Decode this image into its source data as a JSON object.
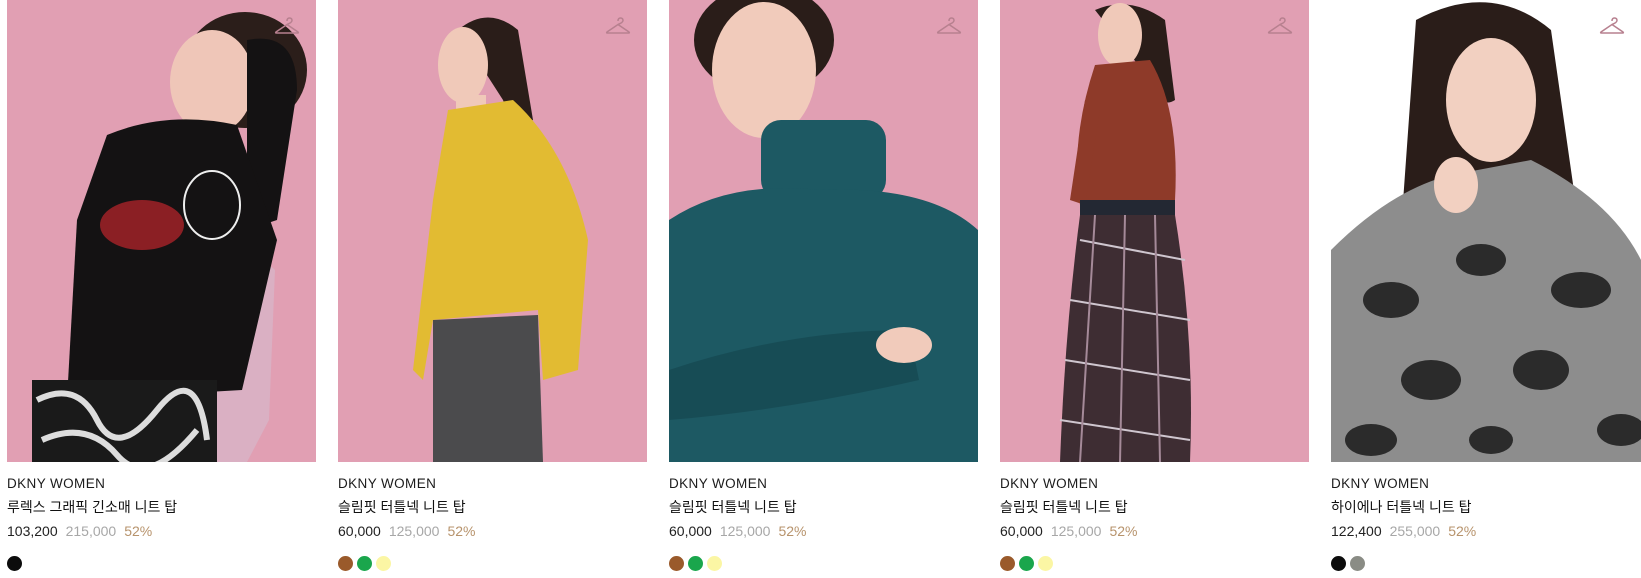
{
  "products": [
    {
      "brand": "DKNY WOMEN",
      "name": "루렉스 그래픽 긴소매 니트 탑",
      "sale_price": "103,200",
      "original_price": "215,000",
      "discount": "52%",
      "image": {
        "background": "#e19fb3",
        "garment": "#141213",
        "pose": "seated-on-chair"
      },
      "swatches": [
        "#0c0c0c"
      ],
      "icon": "hanger-icon"
    },
    {
      "brand": "DKNY WOMEN",
      "name": "슬림핏 터틀넥 니트 탑",
      "sale_price": "60,000",
      "original_price": "125,000",
      "discount": "52%",
      "image": {
        "background": "#e19fb3",
        "garment": "#e2bb32",
        "pose": "side-profile"
      },
      "swatches": [
        "#9a5a2b",
        "#1aa64c",
        "#fbf6a4"
      ],
      "icon": "hanger-icon"
    },
    {
      "brand": "DKNY WOMEN",
      "name": "슬림핏 터틀넥 니트 탑",
      "sale_price": "60,000",
      "original_price": "125,000",
      "discount": "52%",
      "image": {
        "background": "#e19fb3",
        "garment": "#1d5963",
        "pose": "arms-crossed"
      },
      "swatches": [
        "#9a5a2b",
        "#1aa64c",
        "#fbf6a4"
      ],
      "icon": "hanger-icon"
    },
    {
      "brand": "DKNY WOMEN",
      "name": "슬림핏 터틀넥 니트 탑",
      "sale_price": "60,000",
      "original_price": "125,000",
      "discount": "52%",
      "image": {
        "background": "#e19fb3",
        "garment": "#8e3a29",
        "pose": "standing-with-skirt"
      },
      "swatches": [
        "#9a5a2b",
        "#1aa64c",
        "#fbf6a4"
      ],
      "icon": "hanger-icon"
    },
    {
      "brand": "DKNY WOMEN",
      "name": "하이에나 터틀넥 니트 탑",
      "sale_price": "122,400",
      "original_price": "255,000",
      "discount": "52%",
      "image": {
        "background": "#ffffff",
        "garment": "#8d8d8d",
        "pose": "hand-at-collar"
      },
      "swatches": [
        "#0c0c0c",
        "#8a8c85"
      ],
      "icon": "hanger-icon"
    }
  ]
}
